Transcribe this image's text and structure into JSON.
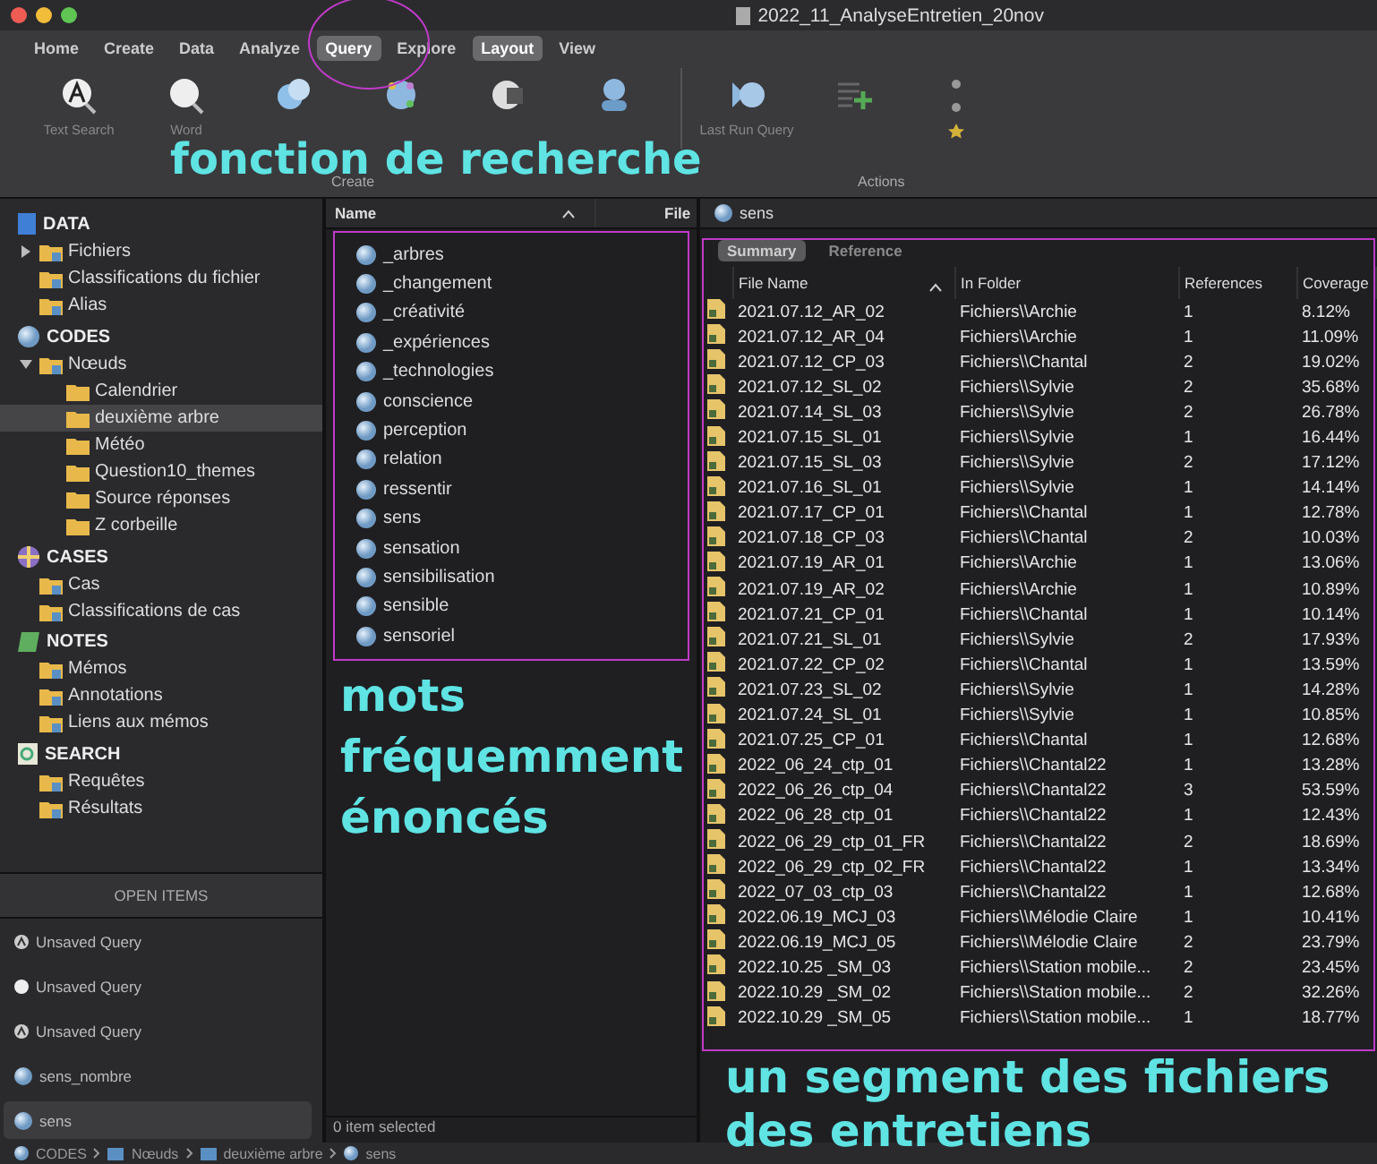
{
  "window": {
    "title": "2022_11_AnalyseEntretien_20nov"
  },
  "tabs": [
    {
      "label": "Home",
      "selected": false
    },
    {
      "label": "Create",
      "selected": false
    },
    {
      "label": "Data",
      "selected": false
    },
    {
      "label": "Analyze",
      "selected": false
    },
    {
      "label": "Query",
      "selected": true
    },
    {
      "label": "Explore",
      "selected": false
    },
    {
      "label": "Layout",
      "selected": true
    },
    {
      "label": "View",
      "selected": false
    }
  ],
  "ribbon": {
    "items": [
      {
        "kind": "text-search",
        "label": "Text Search"
      },
      {
        "kind": "word",
        "label": "Word"
      },
      {
        "kind": "coding"
      },
      {
        "kind": "matrix"
      },
      {
        "kind": "crosstab"
      },
      {
        "kind": "group"
      },
      {
        "kind": "last-run",
        "label": "Last Run Query"
      },
      {
        "kind": "add"
      },
      {
        "kind": "list"
      }
    ],
    "group_labels": [
      "Create",
      "Actions"
    ]
  },
  "sidebar": {
    "sections": [
      {
        "title": "DATA",
        "kind": "data",
        "items": [
          {
            "label": "Fichiers",
            "expanded": false,
            "selected": false
          },
          {
            "label": "Classifications du fichier",
            "selected": false
          },
          {
            "label": "Alias",
            "selected": false
          }
        ]
      },
      {
        "title": "CODES",
        "kind": "codes",
        "items": [
          {
            "label": "Nœuds",
            "expanded": true,
            "selected": false,
            "children": [
              {
                "label": "Calendrier",
                "selected": false
              },
              {
                "label": "deuxième arbre",
                "selected": true
              },
              {
                "label": "Météo",
                "selected": false
              },
              {
                "label": "Question10_themes",
                "selected": false
              },
              {
                "label": "Source réponses",
                "selected": false
              },
              {
                "label": "Z corbeille",
                "selected": false
              }
            ]
          }
        ]
      },
      {
        "title": "CASES",
        "kind": "cases",
        "items": [
          {
            "label": "Cas",
            "selected": false
          },
          {
            "label": "Classifications de cas",
            "selected": false
          }
        ]
      },
      {
        "title": "NOTES",
        "kind": "notes",
        "items": [
          {
            "label": "Mémos",
            "selected": false
          },
          {
            "label": "Annotations",
            "selected": false
          },
          {
            "label": "Liens aux mémos",
            "selected": false
          }
        ]
      },
      {
        "title": "SEARCH",
        "kind": "search",
        "items": [
          {
            "label": "Requêtes",
            "selected": false
          },
          {
            "label": "Résultats",
            "selected": false
          }
        ]
      }
    ]
  },
  "open_items": {
    "title": "OPEN ITEMS",
    "items": [
      {
        "label": "Unsaved Query",
        "kind": "query",
        "selected": false
      },
      {
        "label": "Unsaved Query",
        "kind": "word",
        "selected": false
      },
      {
        "label": "Unsaved Query",
        "kind": "query",
        "selected": false
      },
      {
        "label": "sens_nombre",
        "kind": "code",
        "selected": false
      },
      {
        "label": "sens",
        "kind": "code",
        "selected": true
      }
    ]
  },
  "list_pane": {
    "columns": [
      "Name",
      "File"
    ],
    "items": [
      "_arbres",
      "_changement",
      "_créativité",
      "_expériences",
      "_technologies",
      "conscience",
      "perception",
      "relation",
      "ressentir",
      "sens",
      "sensation",
      "sensibilisation",
      "sensible",
      "sensoriel"
    ],
    "status": "0 item selected"
  },
  "detail": {
    "tab": "sens",
    "subtabs": [
      {
        "label": "Summary",
        "selected": true
      },
      {
        "label": "Reference",
        "selected": false
      }
    ],
    "columns": [
      "File Name",
      "In Folder",
      "References",
      "Coverage"
    ],
    "rows": [
      [
        "2021.07.12_AR_02",
        "Fichiers\\\\Archie",
        "1",
        "8.12%"
      ],
      [
        "2021.07.12_AR_04",
        "Fichiers\\\\Archie",
        "1",
        "11.09%"
      ],
      [
        "2021.07.12_CP_03",
        "Fichiers\\\\Chantal",
        "2",
        "19.02%"
      ],
      [
        "2021.07.12_SL_02",
        "Fichiers\\\\Sylvie",
        "2",
        "35.68%"
      ],
      [
        "2021.07.14_SL_03",
        "Fichiers\\\\Sylvie",
        "2",
        "26.78%"
      ],
      [
        "2021.07.15_SL_01",
        "Fichiers\\\\Sylvie",
        "1",
        "16.44%"
      ],
      [
        "2021.07.15_SL_03",
        "Fichiers\\\\Sylvie",
        "2",
        "17.12%"
      ],
      [
        "2021.07.16_SL_01",
        "Fichiers\\\\Sylvie",
        "1",
        "14.14%"
      ],
      [
        "2021.07.17_CP_01",
        "Fichiers\\\\Chantal",
        "1",
        "12.78%"
      ],
      [
        "2021.07.18_CP_03",
        "Fichiers\\\\Chantal",
        "2",
        "10.03%"
      ],
      [
        "2021.07.19_AR_01",
        "Fichiers\\\\Archie",
        "1",
        "13.06%"
      ],
      [
        "2021.07.19_AR_02",
        "Fichiers\\\\Archie",
        "1",
        "10.89%"
      ],
      [
        "2021.07.21_CP_01",
        "Fichiers\\\\Chantal",
        "1",
        "10.14%"
      ],
      [
        "2021.07.21_SL_01",
        "Fichiers\\\\Sylvie",
        "2",
        "17.93%"
      ],
      [
        "2021.07.22_CP_02",
        "Fichiers\\\\Chantal",
        "1",
        "13.59%"
      ],
      [
        "2021.07.23_SL_02",
        "Fichiers\\\\Sylvie",
        "1",
        "14.28%"
      ],
      [
        "2021.07.24_SL_01",
        "Fichiers\\\\Sylvie",
        "1",
        "10.85%"
      ],
      [
        "2021.07.25_CP_01",
        "Fichiers\\\\Chantal",
        "1",
        "12.68%"
      ],
      [
        "2022_06_24_ctp_01",
        "Fichiers\\\\Chantal22",
        "1",
        "13.28%"
      ],
      [
        "2022_06_26_ctp_04",
        "Fichiers\\\\Chantal22",
        "3",
        "53.59%"
      ],
      [
        "2022_06_28_ctp_01",
        "Fichiers\\\\Chantal22",
        "1",
        "12.43%"
      ],
      [
        "2022_06_29_ctp_01_FR",
        "Fichiers\\\\Chantal22",
        "2",
        "18.69%"
      ],
      [
        "2022_06_29_ctp_02_FR",
        "Fichiers\\\\Chantal22",
        "1",
        "13.34%"
      ],
      [
        "2022_07_03_ctp_03",
        "Fichiers\\\\Chantal22",
        "1",
        "12.68%"
      ],
      [
        "2022.06.19_MCJ_03",
        "Fichiers\\\\Mélodie Claire",
        "1",
        "10.41%"
      ],
      [
        "2022.06.19_MCJ_05",
        "Fichiers\\\\Mélodie Claire",
        "2",
        "23.79%"
      ],
      [
        "2022.10.25 _SM_03",
        "Fichiers\\\\Station mobile...",
        "2",
        "23.45%"
      ],
      [
        "2022.10.29 _SM_02",
        "Fichiers\\\\Station mobile...",
        "2",
        "32.26%"
      ],
      [
        "2022.10.29 _SM_05",
        "Fichiers\\\\Station mobile...",
        "1",
        "18.77%"
      ]
    ]
  },
  "breadcrumb": [
    "CODES",
    "Nœuds",
    "deuxième arbre",
    "sens"
  ],
  "annotations": [
    {
      "kind": "ribbon",
      "text": "fonction de recherche"
    },
    {
      "kind": "list",
      "text": "mots fréquemment énoncés"
    },
    {
      "kind": "table",
      "text": "un segment des fichiers des entretiens"
    }
  ]
}
